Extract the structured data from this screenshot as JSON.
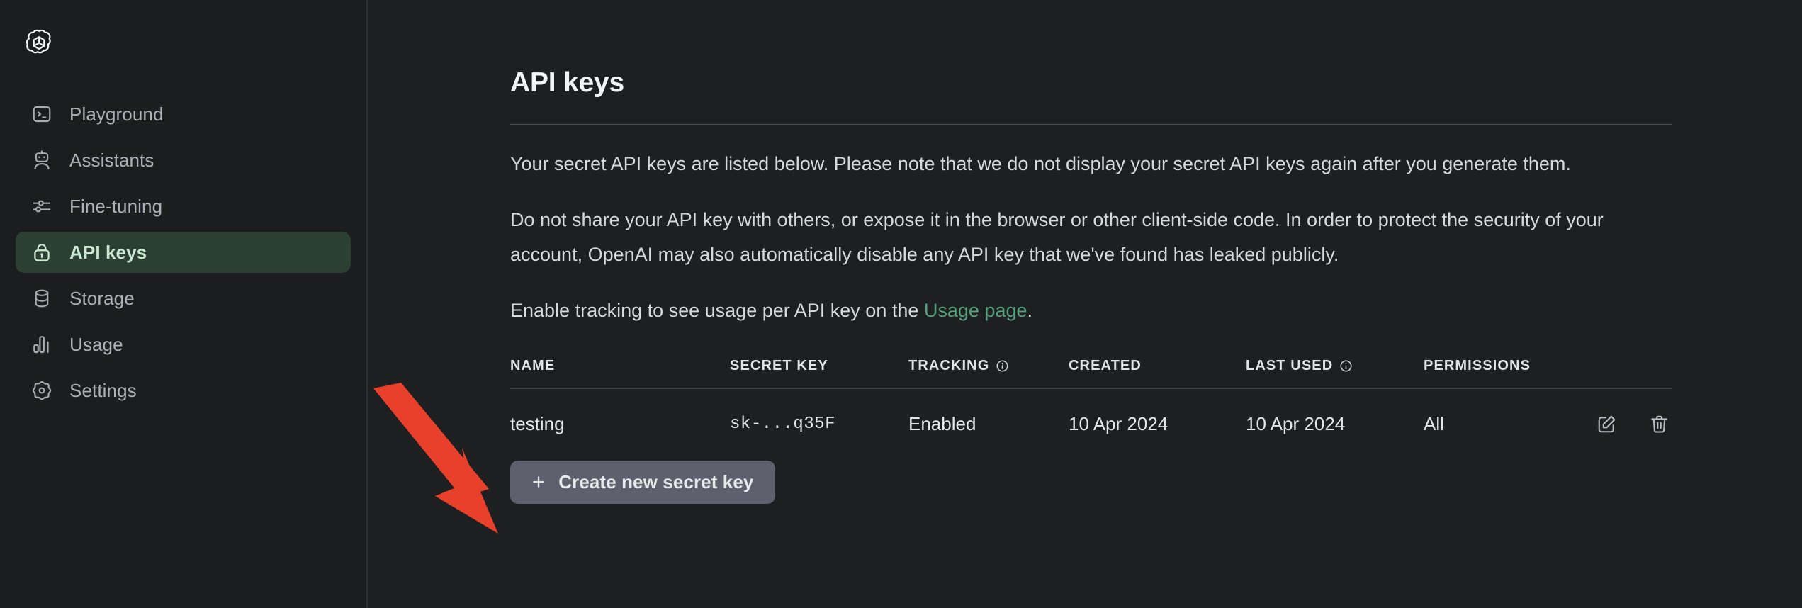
{
  "brand": {
    "logo_icon": "openai-logo"
  },
  "sidebar": {
    "items": [
      {
        "label": "Playground",
        "icon": "terminal-icon",
        "active": false
      },
      {
        "label": "Assistants",
        "icon": "robot-icon",
        "active": false
      },
      {
        "label": "Fine-tuning",
        "icon": "sliders-icon",
        "active": false
      },
      {
        "label": "API keys",
        "icon": "lock-icon",
        "active": true
      },
      {
        "label": "Storage",
        "icon": "database-icon",
        "active": false
      },
      {
        "label": "Usage",
        "icon": "bar-chart-icon",
        "active": false
      },
      {
        "label": "Settings",
        "icon": "gear-icon",
        "active": false
      }
    ]
  },
  "main": {
    "title": "API keys",
    "paragraphs": {
      "p1": "Your secret API keys are listed below. Please note that we do not display your secret API keys again after you generate them.",
      "p2": "Do not share your API key with others, or expose it in the browser or other client-side code. In order to protect the security of your account, OpenAI may also automatically disable any API key that we've found has leaked publicly.",
      "p3_before": "Enable tracking to see usage per API key on the ",
      "p3_link": "Usage page",
      "p3_after": "."
    },
    "table": {
      "headers": {
        "name": "NAME",
        "secret_key": "SECRET KEY",
        "tracking": "TRACKING",
        "created": "CREATED",
        "last_used": "LAST USED",
        "permissions": "PERMISSIONS"
      },
      "header_info_icons": {
        "tracking": "info-circle-icon",
        "last_used": "info-circle-icon"
      },
      "rows": [
        {
          "name": "testing",
          "secret_key": "sk-...q35F",
          "tracking": "Enabled",
          "created": "10 Apr 2024",
          "last_used": "10 Apr 2024",
          "permissions": "All",
          "actions": {
            "edit": "edit-icon",
            "delete": "trash-icon"
          }
        }
      ]
    },
    "create_button": {
      "plus": "+",
      "label": "Create new secret key"
    }
  },
  "annotation": {
    "arrow_color": "#e8402a",
    "arrow_icon": "red-pointer-arrow"
  },
  "colors": {
    "background": "#1e1f20",
    "sidebar_background": "#1c1d1e",
    "active_item_background": "#2b4033",
    "active_item_text": "#cbe8d2",
    "link_green": "#53a07c",
    "button_background": "#5f5f6d",
    "annotation_red": "#e8402a"
  }
}
